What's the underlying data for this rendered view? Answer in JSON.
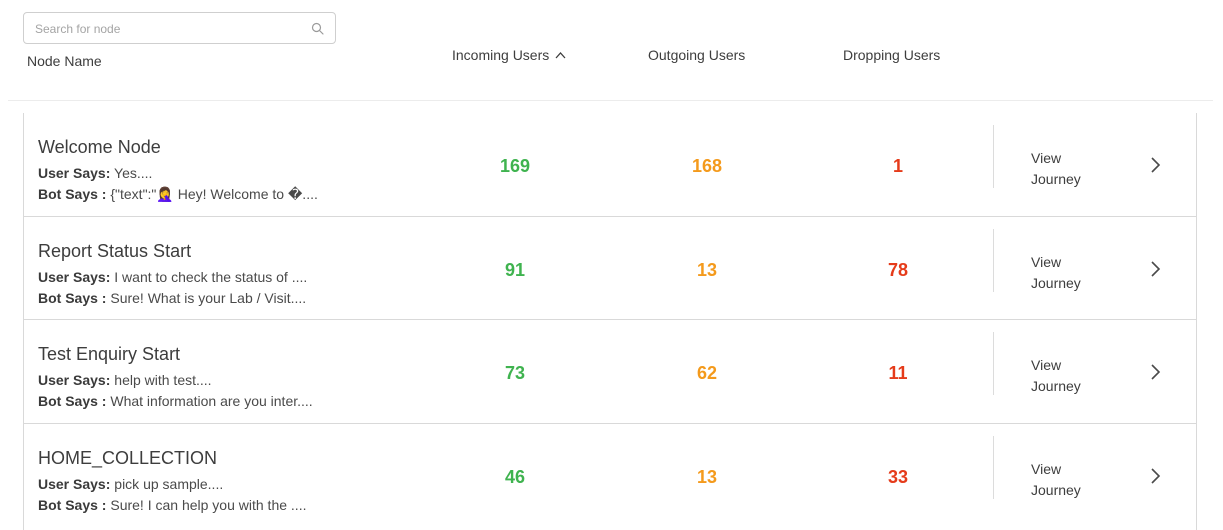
{
  "search": {
    "placeholder": "Search for node",
    "value": "",
    "icon": "search-icon"
  },
  "headers": {
    "node_name": "Node Name",
    "incoming": "Incoming Users",
    "outgoing": "Outgoing Users",
    "dropping": "Dropping Users",
    "sort_icon": "caret-up-icon"
  },
  "colors": {
    "incoming": "#3fb34f",
    "outgoing": "#f49a1c",
    "dropping": "#e53b1a",
    "border": "#d9d9d9"
  },
  "rows": [
    {
      "title": "Welcome Node",
      "user_label": "User Says:",
      "user_text": " Yes....",
      "bot_label": "Bot Says :",
      "bot_text": " {\"text\":\"🤦‍♀️ Hey! Welcome to �....",
      "incoming": "169",
      "outgoing": "168",
      "dropping": "1",
      "view_line1": "View",
      "view_line2": "Journey"
    },
    {
      "title": "Report Status Start",
      "user_label": "User Says:",
      "user_text": " I want to check the status of ....",
      "bot_label": "Bot Says :",
      "bot_text": " Sure! What is your Lab / Visit....",
      "incoming": "91",
      "outgoing": "13",
      "dropping": "78",
      "view_line1": "View",
      "view_line2": "Journey"
    },
    {
      "title": "Test Enquiry Start",
      "user_label": "User Says:",
      "user_text": " help with test....",
      "bot_label": "Bot Says :",
      "bot_text": " What information are you inter....",
      "incoming": "73",
      "outgoing": "62",
      "dropping": "11",
      "view_line1": "View",
      "view_line2": "Journey"
    },
    {
      "title": "HOME_COLLECTION",
      "user_label": "User Says:",
      "user_text": " pick up sample....",
      "bot_label": "Bot Says :",
      "bot_text": " Sure! I can help you with the ....",
      "incoming": "46",
      "outgoing": "13",
      "dropping": "33",
      "view_line1": "View",
      "view_line2": "Journey"
    }
  ]
}
